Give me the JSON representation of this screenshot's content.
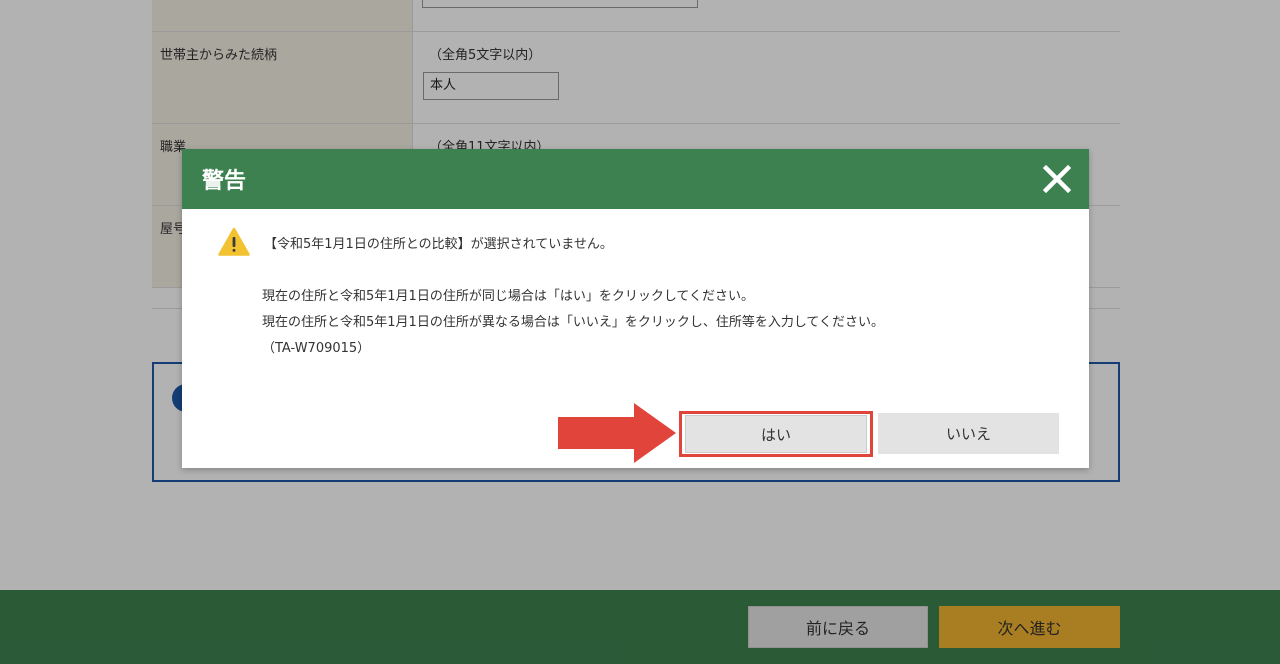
{
  "form": {
    "rows": [
      {
        "label": "世帯主からみた続柄",
        "hint": "（全角5文字以内）",
        "value": "本人"
      },
      {
        "label": "職業",
        "hint": "（全角11文字以内）"
      },
      {
        "label": "屋号"
      }
    ]
  },
  "footer": {
    "back_label": "前に戻る",
    "next_label": "次へ進む"
  },
  "modal": {
    "title": "警告",
    "close_icon": "close-icon",
    "warning_icon": "warning-triangle-icon",
    "warning_message": "【令和5年1月1日の住所との比較】が選択されていません。",
    "instruction_1": "現在の住所と令和5年1月1日の住所が同じ場合は「はい」をクリックしてください。",
    "instruction_2": "現在の住所と令和5年1月1日の住所が異なる場合は「いいえ」をクリックし、住所等を入力してください。",
    "error_code": "（TA-W709015）",
    "yes_label": "はい",
    "no_label": "いいえ"
  },
  "colors": {
    "header_green": "#3e8150",
    "highlight_red": "#e0443a",
    "next_button": "#f2b531",
    "warning_yellow": "#f2c230",
    "info_blue": "#1e5aa8"
  }
}
